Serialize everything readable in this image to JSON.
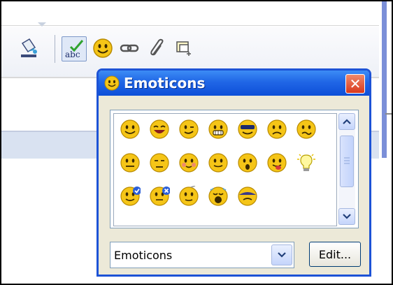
{
  "dialog": {
    "title": "Emoticons",
    "close_label": "✕"
  },
  "toolbar": {
    "icons": [
      "paint-bucket-icon",
      "spellcheck-icon",
      "emoticon-icon",
      "link-icon",
      "paperclip-icon",
      "insert-window-icon"
    ],
    "spellcheck_label": "abc"
  },
  "emoticons": [
    [
      "smile",
      "laugh",
      "wink",
      "grin",
      "cool",
      "frown",
      "confused"
    ],
    [
      "silly",
      "sad",
      "blush",
      "neutral",
      "surprised",
      "tongue",
      "idea-bulb"
    ],
    [
      "check",
      "cancel",
      "thinking",
      "crying",
      "shy"
    ]
  ],
  "category_select": {
    "value": "Emoticons"
  },
  "edit_button": {
    "label": "Edit..."
  },
  "colors": {
    "titlebar": "#2066e6",
    "face": "#f5c517",
    "close": "#d9381c"
  }
}
